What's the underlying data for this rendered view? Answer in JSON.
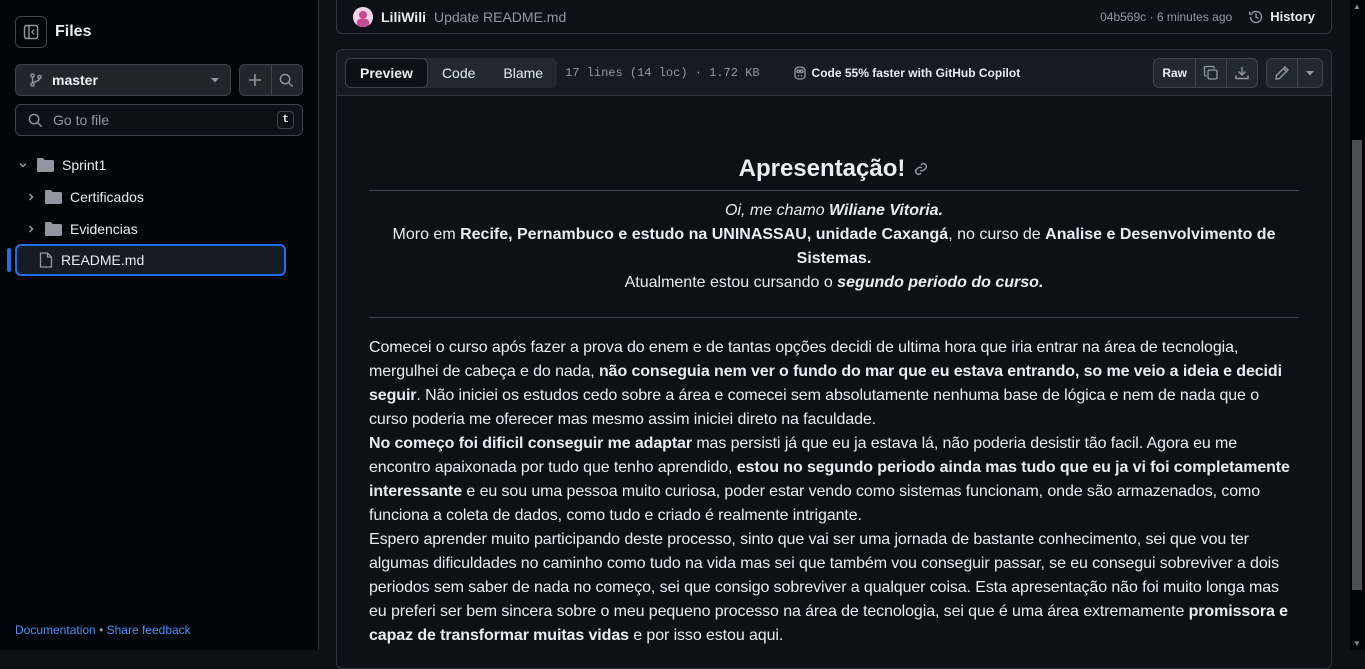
{
  "sidebar": {
    "title": "Files",
    "branch": "master",
    "goto_placeholder": "Go to file",
    "goto_kbd": "t",
    "tree": [
      {
        "label": "Sprint1",
        "type": "folder",
        "expanded": true
      },
      {
        "label": "Certificados",
        "type": "folder",
        "expanded": false
      },
      {
        "label": "Evidencias",
        "type": "folder",
        "expanded": false
      },
      {
        "label": "README.md",
        "type": "file",
        "selected": true
      }
    ],
    "footer": {
      "docs": "Documentation",
      "sep": "•",
      "feedback": "Share feedback"
    }
  },
  "commit": {
    "author": "LiliWili",
    "message": "Update README.md",
    "meta": "04b569c · 6 minutes ago",
    "history": "History"
  },
  "file_header": {
    "tabs": [
      "Preview",
      "Code",
      "Blame"
    ],
    "selected_tab": "Preview",
    "meta": "17 lines (14 loc) · 1.72 KB",
    "copilot": "Code 55% faster with GitHub Copilot",
    "raw": "Raw"
  },
  "readme": {
    "title": "Apresentação!",
    "intro_1a": "Oi, me chamo ",
    "intro_1b": "Wiliane Vitoria.",
    "intro_2a": "Moro em ",
    "intro_2b": "Recife, Pernambuco e estudo na UNINASSAU, unidade Caxangá",
    "intro_2c": ", no curso de ",
    "intro_2d": "Analise e Desenvolvimento de Sistemas.",
    "intro_3a": "Atualmente estou cursando o ",
    "intro_3b": "segundo periodo do curso.",
    "p1a": "Comecei o curso após fazer a prova do enem e de tantas opções decidi de ultima hora que iria entrar na área de tecnologia, mergulhei de cabeça e do nada, ",
    "p1b": "não conseguia nem ver o fundo do mar que eu estava entrando, so me veio a ideia e decidi seguir",
    "p1c": ". Não iniciei os estudos cedo sobre a área e comecei sem absolutamente nenhuma base de lógica e nem de nada que o curso poderia me oferecer mas mesmo assim iniciei direto na faculdade.",
    "p2a": "No começo foi dificil conseguir me adaptar",
    "p2b": " mas persisti já que eu ja estava lá, não poderia desistir tão facil. Agora eu me encontro apaixonada por tudo que tenho aprendido, ",
    "p2c": "estou no segundo periodo ainda mas tudo que eu ja vi foi completamente interessante",
    "p2d": " e eu sou uma pessoa muito curiosa, poder estar vendo como sistemas funcionam, onde são armazenados, como funciona a coleta de dados, como tudo e criado é realmente intrigante.",
    "p3a": "Espero aprender muito participando deste processo, sinto que vai ser uma jornada de bastante conhecimento, sei que vou ter algumas dificuldades no caminho como tudo na vida mas sei que também vou conseguir passar, se eu consegui sobreviver a dois periodos sem saber de nada no começo, sei que consigo sobreviver a qualquer coisa. Esta apresentação não foi muito longa mas eu preferi ser bem sincera sobre o meu pequeno processo na área de tecnologia, sei que é uma área extremamente ",
    "p3b": "promissora e capaz de transformar muitas vidas",
    "p3c": " e por isso estou aqui."
  },
  "colors": {
    "accent": "#1f6feb",
    "link": "#4493f8",
    "bg": "#0d1117",
    "sidebar_bg": "#010409"
  }
}
